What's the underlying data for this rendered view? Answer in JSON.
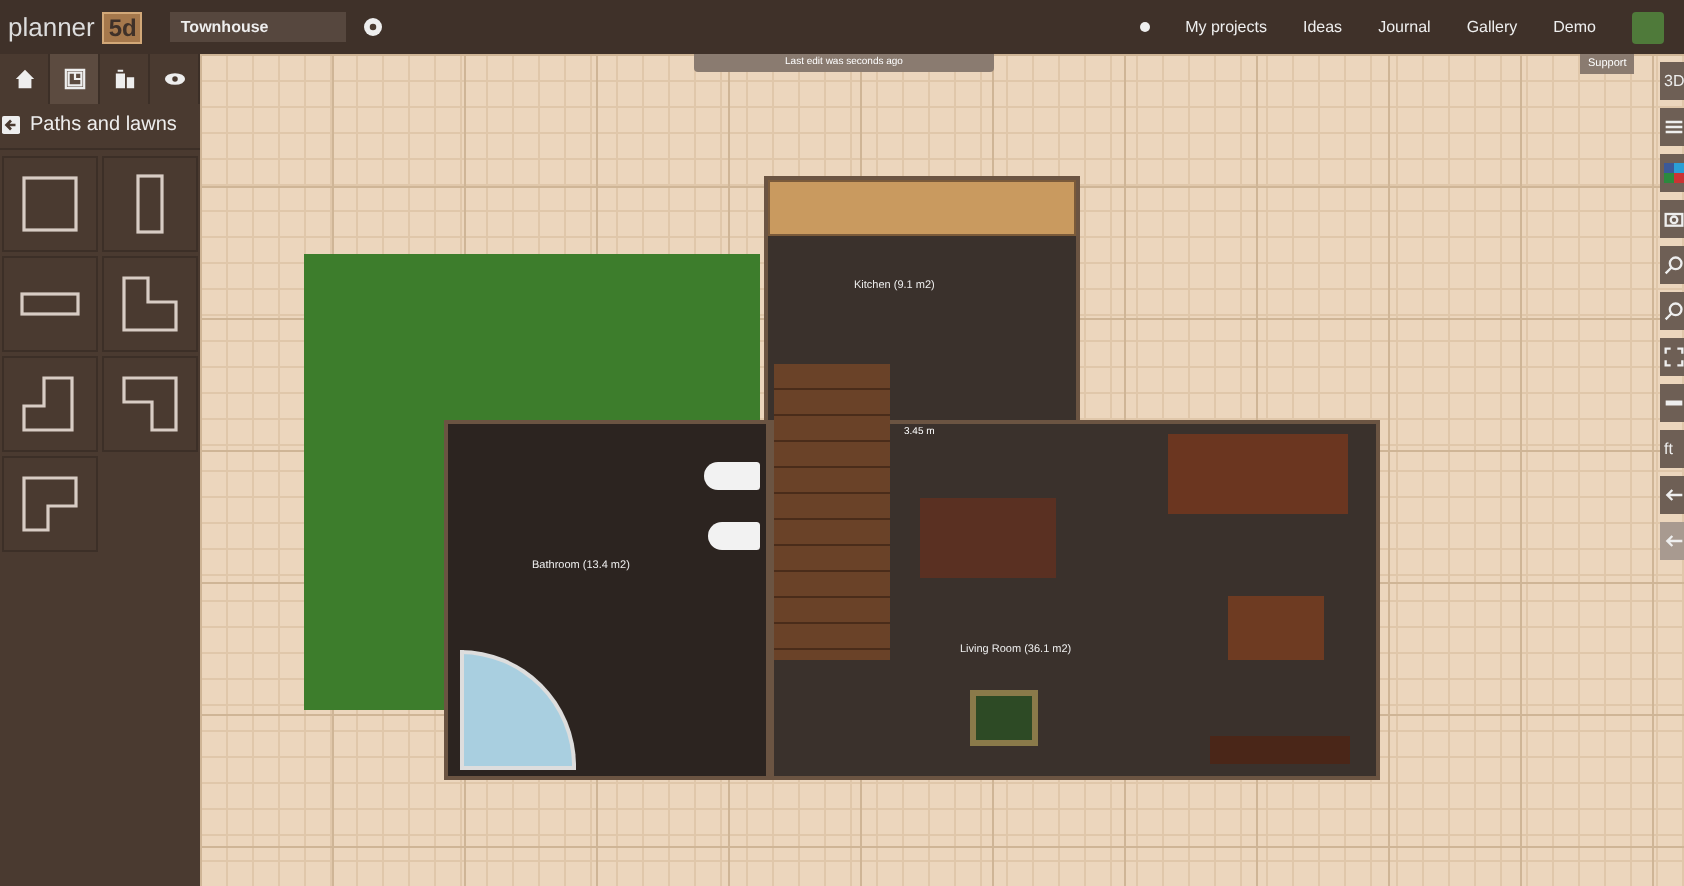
{
  "header": {
    "brand": "planner",
    "logo": "5d",
    "project_name": "Townhouse",
    "nav": [
      {
        "label": "My projects"
      },
      {
        "label": "Ideas"
      },
      {
        "label": "Journal"
      },
      {
        "label": "Gallery"
      },
      {
        "label": "Demo"
      }
    ]
  },
  "status": "Last edit was seconds ago",
  "support": "Support",
  "sidebar": {
    "tabs": [
      {
        "kind": "house",
        "selected": false
      },
      {
        "kind": "floorplan",
        "selected": true
      },
      {
        "kind": "building",
        "selected": false
      },
      {
        "kind": "eye",
        "selected": false
      }
    ],
    "title": "Paths and lawns",
    "shapes": [
      {
        "kind": "square"
      },
      {
        "kind": "tall"
      },
      {
        "kind": "wide"
      },
      {
        "kind": "l-top-left"
      },
      {
        "kind": "l-bottom-left"
      },
      {
        "kind": "l-top-right"
      },
      {
        "kind": "l-top-left-small"
      }
    ]
  },
  "tools": [
    {
      "kind": "text",
      "label": "3D"
    },
    {
      "kind": "list"
    },
    {
      "kind": "social"
    },
    {
      "kind": "camera"
    },
    {
      "kind": "zoom-in"
    },
    {
      "kind": "zoom-out"
    },
    {
      "kind": "fit"
    },
    {
      "kind": "ruler"
    },
    {
      "kind": "text",
      "label": "ft"
    },
    {
      "kind": "undo"
    },
    {
      "kind": "redo",
      "disabled": true
    }
  ],
  "plan": {
    "rooms": [
      {
        "kind": "kitchen",
        "label": "Kitchen (9.1 m2)"
      },
      {
        "kind": "bathroom",
        "label": "Bathroom (13.4 m2)"
      },
      {
        "kind": "living",
        "label": "Living Room (36.1 m2)"
      }
    ],
    "dimension": "3.45 m"
  }
}
